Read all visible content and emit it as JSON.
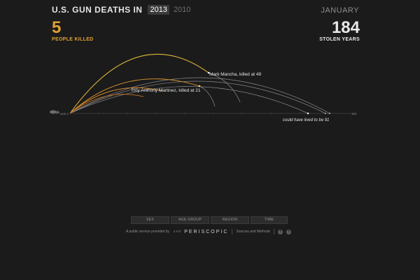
{
  "header": {
    "title": "U.S. GUN DEATHS IN",
    "years": [
      "2013",
      "2010"
    ],
    "selected_year": "2013",
    "month": "JANUARY"
  },
  "stats": {
    "killed_count": "5",
    "killed_label": "PEOPLE KILLED",
    "stolen_count": "184",
    "stolen_label": "STOLEN YEARS"
  },
  "axis": {
    "start_label": "AGE 0",
    "end_label": "100"
  },
  "annotations": {
    "victim_1": "Mark Mancha, killed at 49",
    "victim_2": "Troy Anthony Martinez, killed at 21",
    "note": "could have lived to be 91"
  },
  "filters": [
    "SEX",
    "AGE GROUP",
    "REGION",
    "TIME"
  ],
  "footer": {
    "service_text": "A public service provided by",
    "brand_mark": "∧∧ol",
    "brand": "PERISCOPIC",
    "sources": "Sources and Methods",
    "social": [
      "f",
      "t"
    ]
  },
  "colors": {
    "accent": "#e0a133",
    "killed_arc": "#e0a133",
    "projected_arc": "#8a8a8a"
  }
}
